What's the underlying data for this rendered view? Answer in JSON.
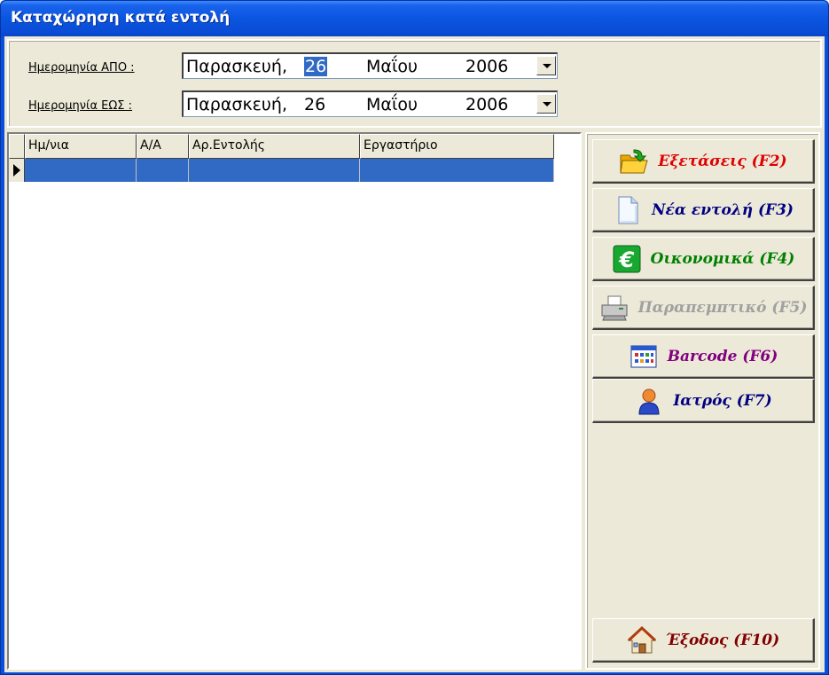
{
  "window": {
    "title": "Καταχώρηση κατά εντολή"
  },
  "dates": {
    "from": {
      "label": "Ημερομηνία ΑΠΟ :",
      "weekday": "Παρασκευή,",
      "day": "26",
      "month": "Μαΐου",
      "year": "2006"
    },
    "to": {
      "label": "Ημερομηνία ΕΩΣ :",
      "weekday": "Παρασκευή,",
      "day": "26",
      "month": "Μαΐου",
      "year": "2006"
    }
  },
  "grid": {
    "columns": [
      "Ημ/νια",
      "Α/Α",
      "Αρ.Εντολής",
      "Εργαστήριο"
    ],
    "rows": [
      [
        "",
        "",
        "",
        ""
      ]
    ]
  },
  "buttons": {
    "exams": {
      "label": "Εξετάσεις  (F2)",
      "color": "#e00000",
      "icon": "folder-arrow-icon"
    },
    "new": {
      "label": "Νέα εντολή (F3)",
      "color": "#000080",
      "icon": "new-document-icon"
    },
    "finance": {
      "label": "Οικονομικά  (F4)",
      "color": "#008000",
      "icon": "euro-icon"
    },
    "referral": {
      "label": "Παραπεμπτικό (F5)",
      "color": "#a0a0a0",
      "icon": "printer-icon"
    },
    "barcode": {
      "label": "Barcode (F6)",
      "color": "#800080",
      "icon": "barcode-grid-icon"
    },
    "doctor": {
      "label": "Ιατρός (F7)",
      "color": "#000080",
      "icon": "doctor-icon"
    },
    "exit": {
      "label": "Έξοδος (F10)",
      "color": "#800000",
      "icon": "home-icon"
    }
  }
}
